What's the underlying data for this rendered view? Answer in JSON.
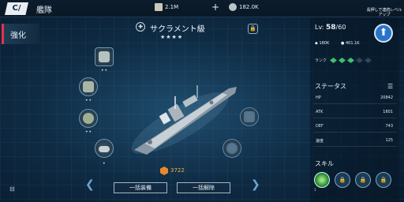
{
  "topbar": {
    "logo": "C/",
    "title": "艦隊",
    "resource_1": "2.1M",
    "resource_2": "182.0K"
  },
  "left_tab": {
    "label": "強化"
  },
  "ship": {
    "name": "サクラメント級",
    "stars": "★★★★"
  },
  "equipment": {
    "slot1_dots": "••",
    "slot2_dots": "••",
    "slot3_dots": "••",
    "slot4_dots": "•"
  },
  "cost": {
    "value": "3722"
  },
  "buttons": {
    "equip_all": "一括装備",
    "unequip_all": "一括解除"
  },
  "panel": {
    "level_label": "Lv:",
    "level": "58",
    "level_max": "/60",
    "res_a": "180K",
    "res_b": "401.1K",
    "rank_label": "ランク",
    "upgrade_label": "長押しで連続レベルアップ",
    "status_title": "ステータス",
    "stats": [
      {
        "key": "HP",
        "value": "20842"
      },
      {
        "key": "ATK",
        "value": "1801"
      },
      {
        "key": "DEF",
        "value": "743"
      },
      {
        "key": "速度",
        "value": "125"
      }
    ],
    "skill_title": "スキル",
    "skill_level": "1"
  },
  "colors": {
    "accent_red": "#e8324a",
    "rank_active": "#3fbf6a",
    "cost": "#f0b040",
    "upgrade_blue": "#2a73c9"
  }
}
